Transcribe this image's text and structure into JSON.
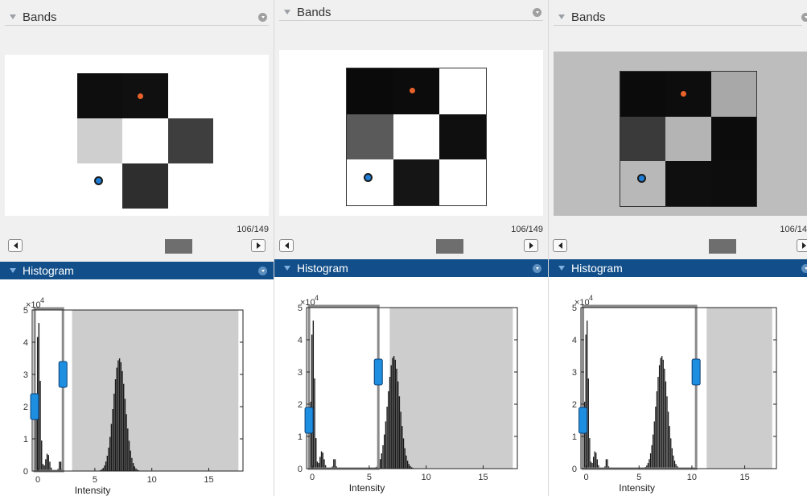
{
  "colors": {
    "histogram_header": "#124f8a",
    "marker_orange": "#e8622a",
    "marker_blue": "#1f7fd8",
    "slider_handle": "#1e8fe0",
    "excluded_region": "#cdcdcd"
  },
  "panels": [
    {
      "bands_title": "Bands",
      "frame_counter": "106/149",
      "histogram_title": "Histogram",
      "board_bg": "#ffffff",
      "board_cells": [
        "#0e0e0e",
        "#101010",
        "#ffffff",
        "#cfcfcf",
        "#ffffff",
        "#3e3e3e",
        "#ffffff",
        "#2e2e2e",
        "#ffffff"
      ]
    },
    {
      "bands_title": "Bands",
      "frame_counter": "106/149",
      "histogram_title": "Histogram",
      "board_bg": "#ffffff",
      "board_cells": [
        "#0a0a0a",
        "#0c0c0c",
        "#ffffff",
        "#5a5a5a",
        "#ffffff",
        "#0f0f0f",
        "#ffffff",
        "#151515",
        "#ffffff"
      ]
    },
    {
      "bands_title": "Bands",
      "frame_counter": "106/14",
      "histogram_title": "Histogram",
      "board_bg": "#bdbdbd",
      "board_cells": [
        "#0b0b0b",
        "#0d0d0d",
        "#a8a8a8",
        "#3a3a3a",
        "#b4b4b4",
        "#0c0c0c",
        "#b8b8b8",
        "#0f0f0f",
        "#0d0d0d"
      ]
    }
  ],
  "chart_data": [
    {
      "type": "bar",
      "xlabel": "Intensity",
      "ylabel": "",
      "y_exponent": "×10",
      "y_exponent_power": "4",
      "xlim": [
        -0.5,
        18
      ],
      "ylim": [
        0,
        5
      ],
      "x_ticks": [
        "0",
        "5",
        "10",
        "15"
      ],
      "y_ticks": [
        "0",
        "1",
        "2",
        "3",
        "4",
        "5"
      ],
      "selection_range": [
        0,
        2.2
      ],
      "excluded_range": [
        3,
        17.6
      ],
      "slider_values": [
        2,
        3
      ]
    },
    {
      "type": "bar",
      "xlabel": "Intensity",
      "ylabel": "",
      "y_exponent": "×10",
      "y_exponent_power": "4",
      "xlim": [
        -0.5,
        18
      ],
      "ylim": [
        0,
        5
      ],
      "x_ticks": [
        "0",
        "5",
        "10",
        "15"
      ],
      "y_ticks": [
        "0",
        "1",
        "2",
        "3",
        "4",
        "5"
      ],
      "selection_range": [
        0,
        5.8
      ],
      "excluded_range": [
        6.8,
        17.6
      ],
      "slider_values": [
        1.5,
        3
      ]
    },
    {
      "type": "bar",
      "xlabel": "Intensity",
      "ylabel": "",
      "y_exponent": "×10",
      "y_exponent_power": "4",
      "xlim": [
        -0.5,
        18
      ],
      "ylim": [
        0,
        5
      ],
      "x_ticks": [
        "0",
        "5",
        "10",
        "15"
      ],
      "y_ticks": [
        "0",
        "1",
        "2",
        "3",
        "4",
        "5"
      ],
      "selection_range": [
        0,
        10.4
      ],
      "excluded_range": [
        11.4,
        17.6
      ],
      "slider_values": [
        1.5,
        3
      ]
    }
  ]
}
